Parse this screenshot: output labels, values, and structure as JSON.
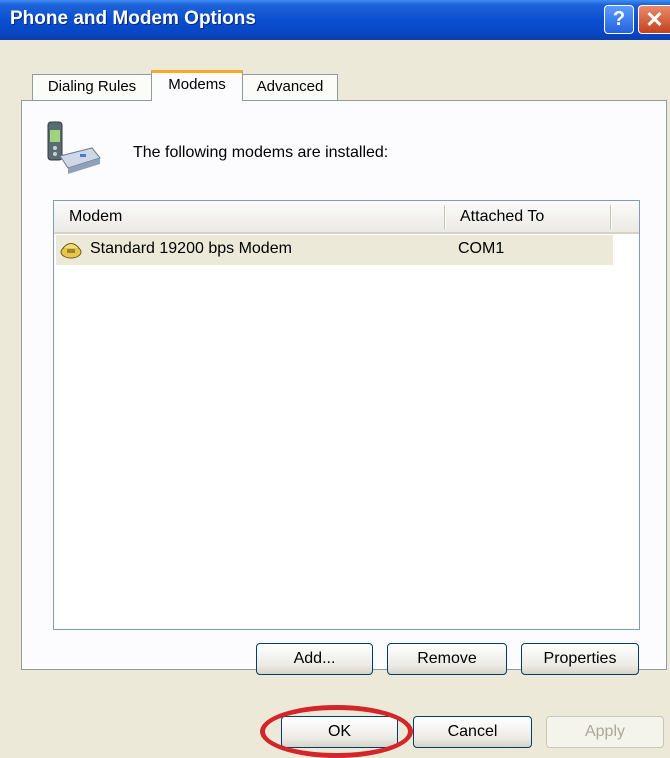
{
  "window": {
    "title": "Phone and Modem Options",
    "help_label": "?",
    "close_label": "✕"
  },
  "tabs": [
    {
      "label": "Dialing Rules",
      "active": false
    },
    {
      "label": "Modems",
      "active": true
    },
    {
      "label": "Advanced",
      "active": false
    }
  ],
  "modems_tab": {
    "intro_text": "The following modems are  installed:",
    "columns": [
      "Modem",
      "Attached To"
    ],
    "rows": [
      {
        "modem": "Standard 19200 bps Modem",
        "attached_to": "COM1",
        "icon": "modem-icon"
      }
    ],
    "buttons": {
      "add": "Add...",
      "remove": "Remove",
      "properties": "Properties"
    }
  },
  "dialog_buttons": {
    "ok": "OK",
    "cancel": "Cancel",
    "apply": "Apply"
  },
  "colors": {
    "titlebar": "#0a4fd0",
    "active_tab_accent": "#f7a92a",
    "selection_row": "#ece9d8",
    "highlight_ring": "#d3262a"
  }
}
